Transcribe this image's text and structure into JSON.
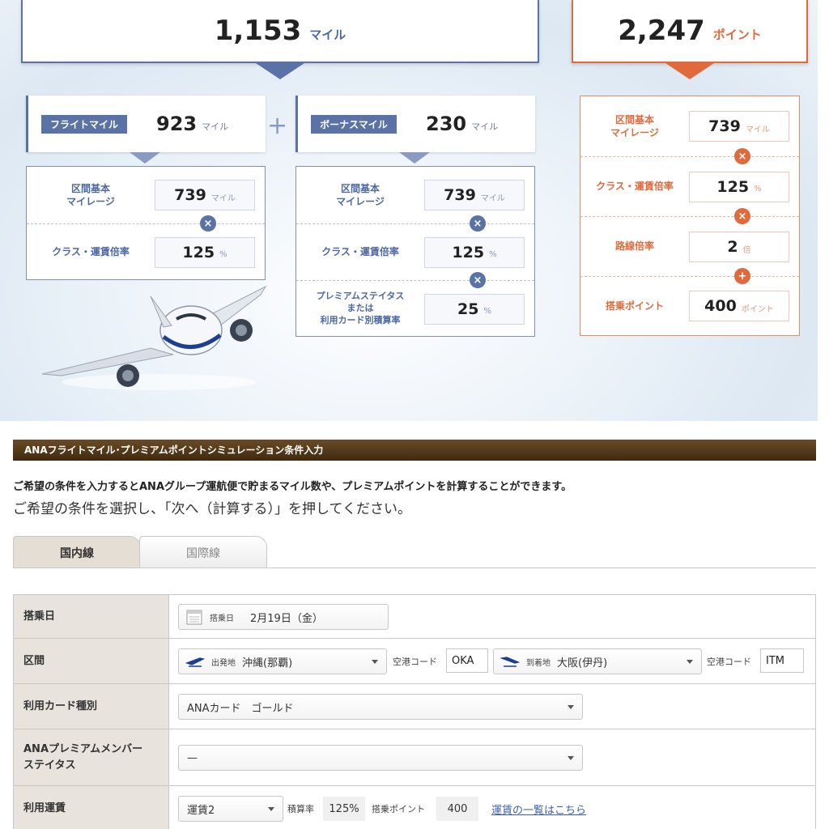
{
  "summary": {
    "total_miles": "1,153",
    "miles_unit": "マイル",
    "total_points": "2,247",
    "points_unit": "ポイント",
    "flight_miles_tag": "フライトマイル",
    "flight_miles": "923",
    "bonus_miles_tag": "ボーナスマイル",
    "bonus_miles": "230",
    "plus": "+"
  },
  "flight_calc": {
    "base_label": "区間基本\nマイレージ",
    "base_value": "739",
    "base_unit": "マイル",
    "rate_label": "クラス・運賃倍率",
    "rate_value": "125",
    "rate_unit": "%"
  },
  "bonus_calc": {
    "base_label": "区間基本\nマイレージ",
    "base_value": "739",
    "base_unit": "マイル",
    "rate_label": "クラス・運賃倍率",
    "rate_value": "125",
    "rate_unit": "%",
    "premium_label": "プレミアムステイタス\nまたは\n利用カード別積算率",
    "premium_value": "25",
    "premium_unit": "%"
  },
  "points_calc": {
    "base_label": "区間基本\nマイレージ",
    "base_value": "739",
    "base_unit": "マイル",
    "rate_label": "クラス・運賃倍率",
    "rate_value": "125",
    "rate_unit": "%",
    "route_label": "路線倍率",
    "route_value": "2",
    "route_unit": "倍",
    "boarding_label": "搭乗ポイント",
    "boarding_value": "400",
    "boarding_unit": "ポイント"
  },
  "operators": {
    "times": "×",
    "plus": "+"
  },
  "simulation": {
    "title": "ANAフライトマイル･プレミアムポイントシミュレーション条件入力",
    "desc1": "ご希望の条件を入力するとANAグループ運航便で貯まるマイル数や、プレミアムポイントを計算することができます。",
    "desc2": "ご希望の条件を選択し、「次へ（計算する）」を押してください。",
    "tabs": [
      "国内線",
      "国際線"
    ]
  },
  "form": {
    "date_label": "搭乗日",
    "date_field_label": "搭乗日",
    "date_value": "2月19日（金）",
    "route_label": "区間",
    "departure_label": "出発地",
    "departure_value": "沖縄(那覇)",
    "airport_code_label": "空港コード",
    "departure_code": "OKA",
    "arrival_label": "到着地",
    "arrival_value": "大阪(伊丹)",
    "arrival_code": "ITM",
    "card_label": "利用カード種別",
    "card_value": "ANAカード　ゴールド",
    "status_label": "ANAプレミアムメンバー\nステイタス",
    "status_value": "—",
    "fare_label": "利用運賃",
    "fare_value": "運賃2",
    "accrual_label": "積算率",
    "accrual_value": "125%",
    "boarding_points_label": "搭乗ポイント",
    "boarding_points_value": "400",
    "fare_list_link": "運賃の一覧はこちら"
  }
}
